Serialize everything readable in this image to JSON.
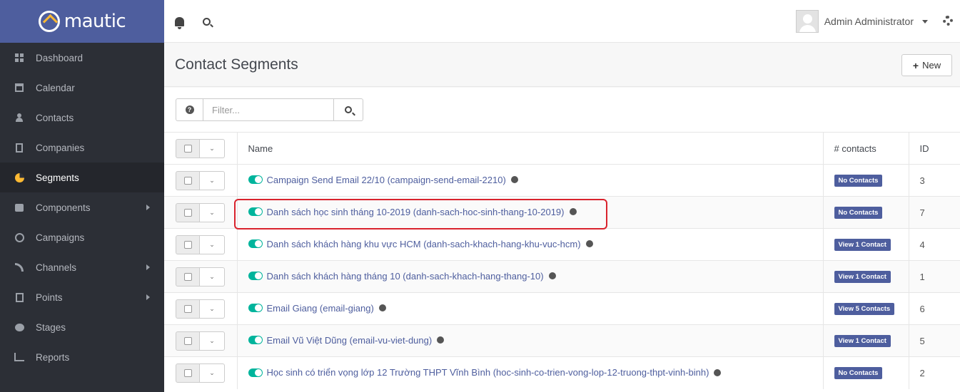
{
  "app": {
    "brand": "mautic"
  },
  "sidebar": {
    "items": [
      {
        "label": "Dashboard",
        "icon": "dashboard-icon",
        "active": false,
        "has_submenu": false
      },
      {
        "label": "Calendar",
        "icon": "calendar-icon",
        "active": false,
        "has_submenu": false
      },
      {
        "label": "Contacts",
        "icon": "user-icon",
        "active": false,
        "has_submenu": false
      },
      {
        "label": "Companies",
        "icon": "building-icon",
        "active": false,
        "has_submenu": false
      },
      {
        "label": "Segments",
        "icon": "pie-chart-icon",
        "active": true,
        "has_submenu": false
      },
      {
        "label": "Components",
        "icon": "puzzle-icon",
        "active": false,
        "has_submenu": true
      },
      {
        "label": "Campaigns",
        "icon": "clock-icon",
        "active": false,
        "has_submenu": false
      },
      {
        "label": "Channels",
        "icon": "rss-icon",
        "active": false,
        "has_submenu": true
      },
      {
        "label": "Points",
        "icon": "calculator-icon",
        "active": false,
        "has_submenu": true
      },
      {
        "label": "Stages",
        "icon": "stages-icon",
        "active": false,
        "has_submenu": false
      },
      {
        "label": "Reports",
        "icon": "line-chart-icon",
        "active": false,
        "has_submenu": false
      }
    ]
  },
  "header": {
    "user_name": "Admin Administrator",
    "icons": [
      "bell-icon",
      "search-icon",
      "gear-icon"
    ]
  },
  "page": {
    "title": "Contact Segments",
    "new_label": "New"
  },
  "filter": {
    "placeholder": "Filter...",
    "value": ""
  },
  "table": {
    "columns": {
      "name": "Name",
      "contacts": "# contacts",
      "id": "ID"
    },
    "rows": [
      {
        "name": "Campaign Send Email 22/10 (campaign-send-email-2210)",
        "contacts": "No Contacts",
        "id": "3"
      },
      {
        "name": "Danh sách học sinh tháng 10-2019 (danh-sach-hoc-sinh-thang-10-2019)",
        "contacts": "No Contacts",
        "id": "7"
      },
      {
        "name": "Danh sách khách hàng khu vực HCM (danh-sach-khach-hang-khu-vuc-hcm)",
        "contacts": "View 1 Contact",
        "id": "4"
      },
      {
        "name": "Danh sách khách hàng tháng 10 (danh-sach-khach-hang-thang-10)",
        "contacts": "View 1 Contact",
        "id": "1"
      },
      {
        "name": "Email Giang (email-giang)",
        "contacts": "View 5 Contacts",
        "id": "6"
      },
      {
        "name": "Email Vũ Việt Dũng (email-vu-viet-dung)",
        "contacts": "View 1 Contact",
        "id": "5"
      },
      {
        "name": "Học sinh có triển vọng lớp 12 Trường THPT Vĩnh Bình (hoc-sinh-co-trien-vong-lop-12-truong-thpt-vinh-binh)",
        "contacts": "No Contacts",
        "id": "2"
      }
    ]
  },
  "colors": {
    "brand": "#4e5e9e",
    "toggle_on": "#00b49c",
    "highlight": "#d9232d",
    "sidebar_bg": "#2c2f36"
  }
}
